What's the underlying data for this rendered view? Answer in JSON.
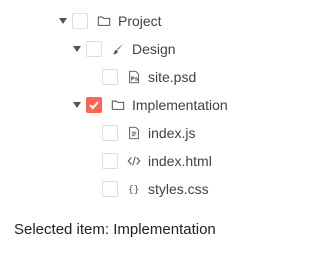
{
  "tree": {
    "items": [
      {
        "label": "Project",
        "icon": "folder-icon",
        "expanded": true,
        "checked": false
      },
      {
        "label": "Design",
        "icon": "brush-icon",
        "expanded": true,
        "checked": false
      },
      {
        "label": "site.psd",
        "icon": "photoshop-file-icon",
        "checked": false
      },
      {
        "label": "Implementation",
        "icon": "folder-icon",
        "expanded": true,
        "checked": true
      },
      {
        "label": "index.js",
        "icon": "javascript-file-icon",
        "checked": false
      },
      {
        "label": "index.html",
        "icon": "html-code-icon",
        "checked": false
      },
      {
        "label": "styles.css",
        "icon": "css-braces-icon",
        "checked": false
      }
    ]
  },
  "status": {
    "text": "Selected item: Implementation"
  },
  "colors": {
    "accent": "#ff6358",
    "text": "#424242",
    "checkbox_border": "#dddddd"
  }
}
